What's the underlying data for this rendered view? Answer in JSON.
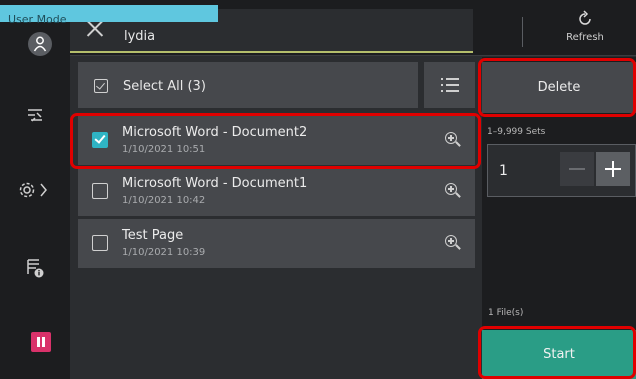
{
  "mode_label": "User Mode",
  "header": {
    "folder_name": "lydia",
    "refresh_label": "Refresh"
  },
  "toolbar": {
    "select_all_label": "Select All (3)"
  },
  "documents": [
    {
      "name": "Microsoft Word - Document2",
      "date": "1/10/2021 10:51",
      "checked": true
    },
    {
      "name": "Microsoft Word - Document1",
      "date": "1/10/2021 10:42",
      "checked": false
    },
    {
      "name": "Test Page",
      "date": "1/10/2021 10:39",
      "checked": false
    }
  ],
  "right_panel": {
    "delete_label": "Delete",
    "sets_range": "1–9,999 Sets",
    "quantity": "1",
    "files_count": "1 File(s)",
    "start_label": "Start"
  },
  "colors": {
    "accent_teal": "#2a9d86",
    "checkbox_on": "#2fb4c4",
    "highlight_red": "#e00000",
    "mode_bar": "#5fc7df",
    "pause_button": "#d9326a"
  },
  "icons": [
    "close-icon",
    "refresh-icon",
    "user-icon",
    "job-list-icon",
    "settings-icon",
    "printer-info-icon",
    "pause-icon",
    "select-all-icon",
    "list-view-icon",
    "zoom-preview-icon",
    "minus-icon",
    "plus-icon"
  ]
}
